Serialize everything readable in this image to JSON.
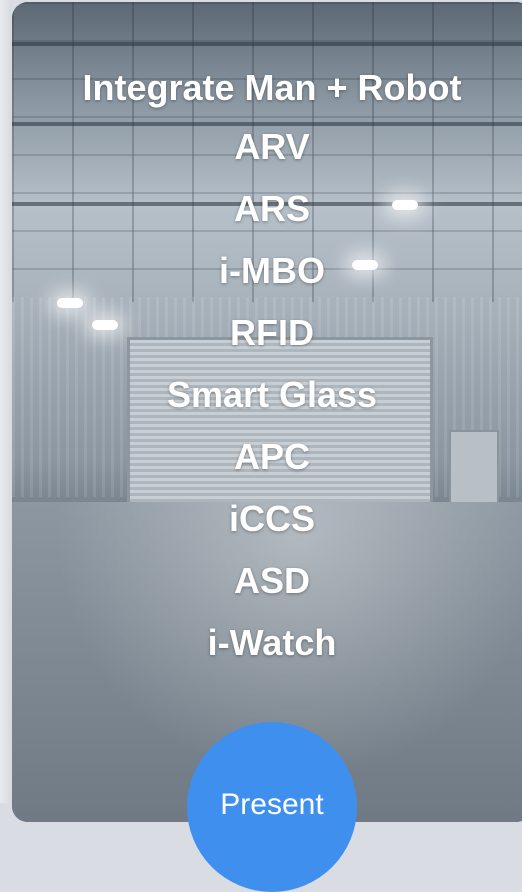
{
  "menu": {
    "items": [
      "Integrate Man + Robot",
      "ARV",
      "ARS",
      "i-MBO",
      "RFID",
      "Smart Glass",
      "APC",
      "iCCS",
      "ASD",
      "i-Watch"
    ]
  },
  "present_button": {
    "label": "Present"
  },
  "colors": {
    "button": "#3f90ee",
    "text": "#ffffff"
  }
}
